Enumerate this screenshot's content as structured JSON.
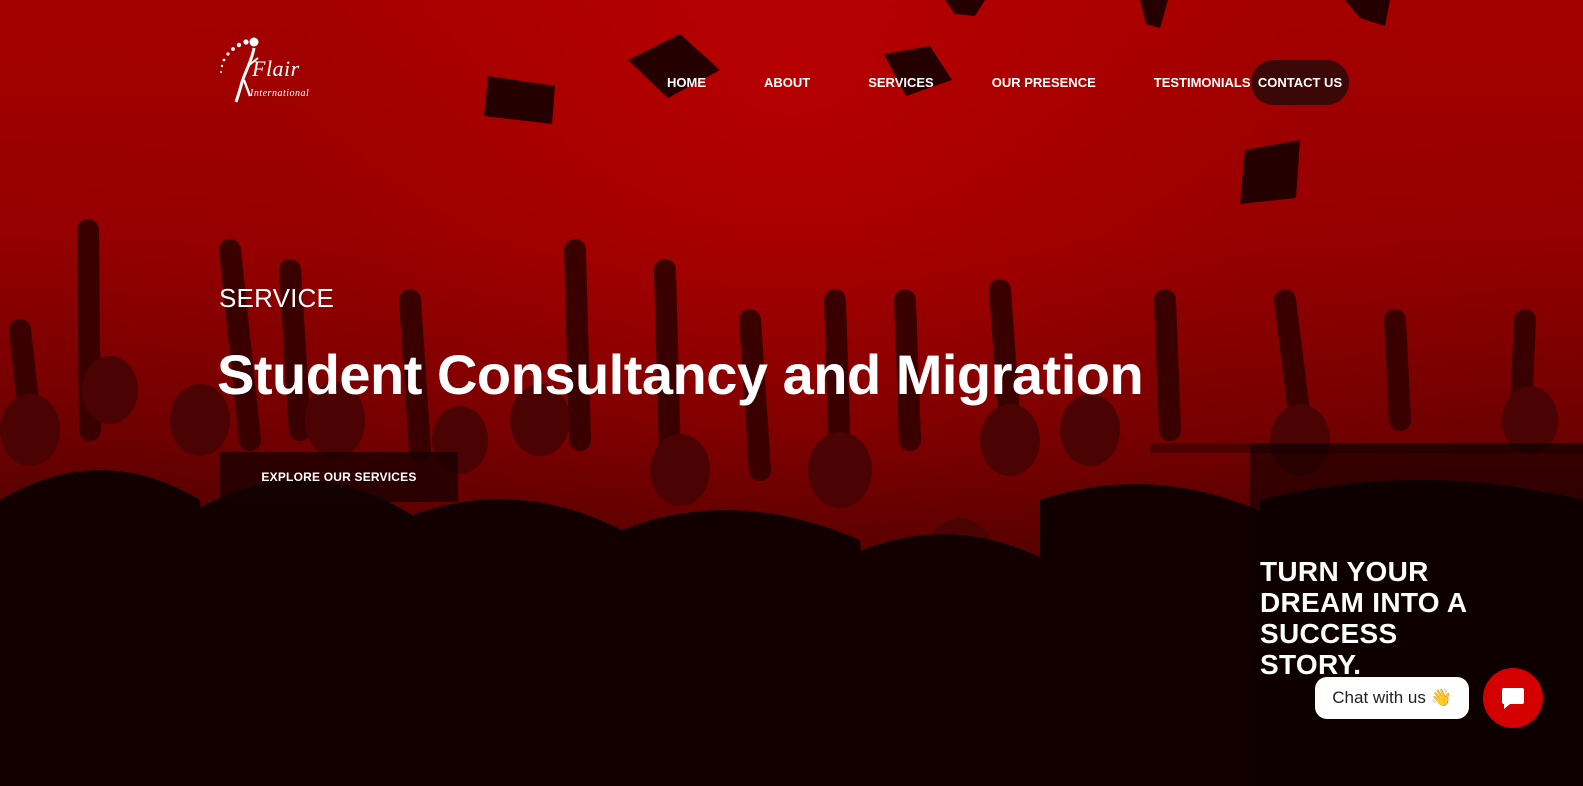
{
  "logo": {
    "name": "Flair",
    "subtitle": "International"
  },
  "nav": {
    "items": [
      {
        "label": "HOME"
      },
      {
        "label": "ABOUT"
      },
      {
        "label": "SERVICES"
      },
      {
        "label": "OUR PRESENCE"
      },
      {
        "label": "TESTIMONIALS"
      }
    ],
    "cta_label": "CONTACT US"
  },
  "hero": {
    "eyebrow": "SERVICE",
    "headline": "Student Consultancy and Migration",
    "button_label": "EXPLORE OUR SERVICES",
    "tagline": "TURN YOUR DREAM INTO A SUCCESS STORY."
  },
  "chat": {
    "bubble_text": "Chat with us 👋",
    "button_icon": "chat-icon"
  },
  "colors": {
    "brand_red": "#d40000",
    "hero_red": "#a50000",
    "cta_dark": "#3b0707"
  }
}
